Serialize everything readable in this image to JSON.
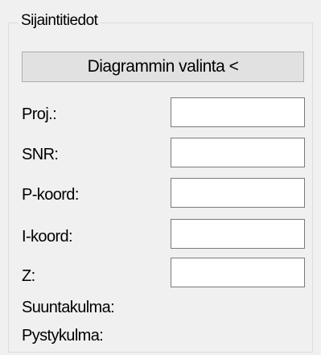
{
  "group": {
    "title": "Sijaintitiedot",
    "diagram_button_label": "Diagrammin valinta <"
  },
  "fields": {
    "proj": {
      "label": "Proj.:",
      "value": ""
    },
    "snr": {
      "label": "SNR:",
      "value": ""
    },
    "p_koord": {
      "label": "P-koord:",
      "value": ""
    },
    "i_koord": {
      "label": "I-koord:",
      "value": ""
    },
    "z": {
      "label": "Z:",
      "value": ""
    },
    "suuntakulma": {
      "label": "Suuntakulma:"
    },
    "pystykulma": {
      "label": "Pystykulma:"
    }
  }
}
